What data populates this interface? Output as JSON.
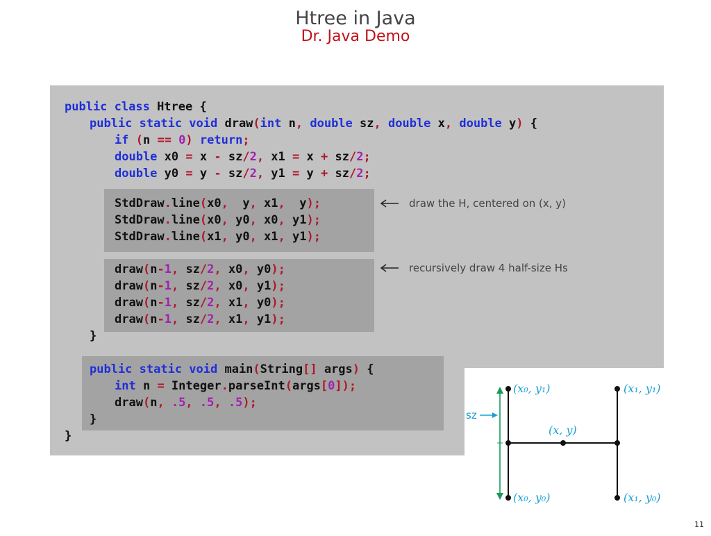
{
  "slide": {
    "title": "Htree in Java",
    "subtitle": "Dr. Java Demo",
    "page_number": "11"
  },
  "code": {
    "l1": {
      "a": "public class",
      "b": " Htree {"
    },
    "l2": {
      "a": "public static void",
      "b": " draw",
      "c": "(",
      "d": "int",
      "e": " n",
      "f": ",",
      "g": " double",
      "h": " sz",
      "i": ",",
      "j": " double",
      "k": " x",
      "l": ",",
      "m": " double",
      "n": " y",
      "o": ")",
      "p": " {"
    },
    "l3": {
      "a": "if",
      "b": " (",
      "c": "n ",
      "d": "==",
      "e": " 0",
      "f": ")",
      "g": " return",
      "h": ";"
    },
    "l4": {
      "a": "double",
      "b": " x0 ",
      "c": "=",
      "d": " x ",
      "e": "-",
      "f": " sz",
      "g": "/",
      "h": "2",
      "i": ",",
      "j": " x1 ",
      "k": "=",
      "l": " x ",
      "m": "+",
      "n": " sz",
      "o": "/",
      "p": "2",
      "q": ";"
    },
    "l5": {
      "a": "double",
      "b": " y0 ",
      "c": "=",
      "d": " y ",
      "e": "-",
      "f": " sz",
      "g": "/",
      "h": "2",
      "i": ",",
      "j": " y1 ",
      "k": "=",
      "l": " y ",
      "m": "+",
      "n": " sz",
      "o": "/",
      "p": "2",
      "q": ";"
    },
    "l6": {
      "a": "StdDraw",
      "b": ".",
      "c": "line",
      "d": "(",
      "e": "x0",
      "f": ",",
      "g": "  y",
      "h": ",",
      "i": " x1",
      "j": ",",
      "k": "  y",
      "l": ");"
    },
    "l7": {
      "a": "StdDraw",
      "b": ".",
      "c": "line",
      "d": "(",
      "e": "x0",
      "f": ",",
      "g": " y0",
      "h": ",",
      "i": " x0",
      "j": ",",
      "k": " y1",
      "l": ");"
    },
    "l8": {
      "a": "StdDraw",
      "b": ".",
      "c": "line",
      "d": "(",
      "e": "x1",
      "f": ",",
      "g": " y0",
      "h": ",",
      "i": " x1",
      "j": ",",
      "k": " y1",
      "l": ");"
    },
    "l9": {
      "a": "draw",
      "b": "(",
      "c": "n",
      "d": "-",
      "e": "1",
      "f": ",",
      "g": " sz",
      "h": "/",
      "i": "2",
      "j": ",",
      "k": " x0",
      "l": ",",
      "m": " y0",
      "n": ");"
    },
    "l10": {
      "a": "draw",
      "b": "(",
      "c": "n",
      "d": "-",
      "e": "1",
      "f": ",",
      "g": " sz",
      "h": "/",
      "i": "2",
      "j": ",",
      "k": " x0",
      "l": ",",
      "m": " y1",
      "n": ");"
    },
    "l11": {
      "a": "draw",
      "b": "(",
      "c": "n",
      "d": "-",
      "e": "1",
      "f": ",",
      "g": " sz",
      "h": "/",
      "i": "2",
      "j": ",",
      "k": " x1",
      "l": ",",
      "m": " y0",
      "n": ");"
    },
    "l12": {
      "a": "draw",
      "b": "(",
      "c": "n",
      "d": "-",
      "e": "1",
      "f": ",",
      "g": " sz",
      "h": "/",
      "i": "2",
      "j": ",",
      "k": " x1",
      "l": ",",
      "m": " y1",
      "n": ");"
    },
    "l13": {
      "a": "}"
    },
    "l14": {
      "a": "public static void",
      "b": " main",
      "c": "(",
      "d": "String",
      "e": "[]",
      "f": " args",
      "g": ")",
      "h": " {"
    },
    "l15": {
      "a": "int",
      "b": " n ",
      "c": "=",
      "d": " Integer",
      "e": ".",
      "f": "parseInt",
      "g": "(",
      "h": "args",
      "i": "[",
      "j": "0",
      "k": "]);"
    },
    "l16": {
      "a": "draw",
      "b": "(",
      "c": "n",
      "d": ",",
      "e": " .5",
      "f": ",",
      "g": " .5",
      "h": ",",
      "i": " .5",
      "j": ");"
    },
    "l17": {
      "a": "}"
    },
    "l18": {
      "a": "}"
    }
  },
  "annotations": {
    "draw_h": "draw the H, centered on (x, y)",
    "recursive": "recursively draw 4 half-size Hs"
  },
  "diagram": {
    "top_left": "(x₀, y₁)",
    "top_right": "(x₁, y₁)",
    "center": "(x, y)",
    "bottom_left": "(x₀, y₀)",
    "bottom_right": "(x₁, y₀)",
    "sz_label": "sz",
    "label_color": "#1a9fd4",
    "arrow_color": "#1a9a5a"
  }
}
